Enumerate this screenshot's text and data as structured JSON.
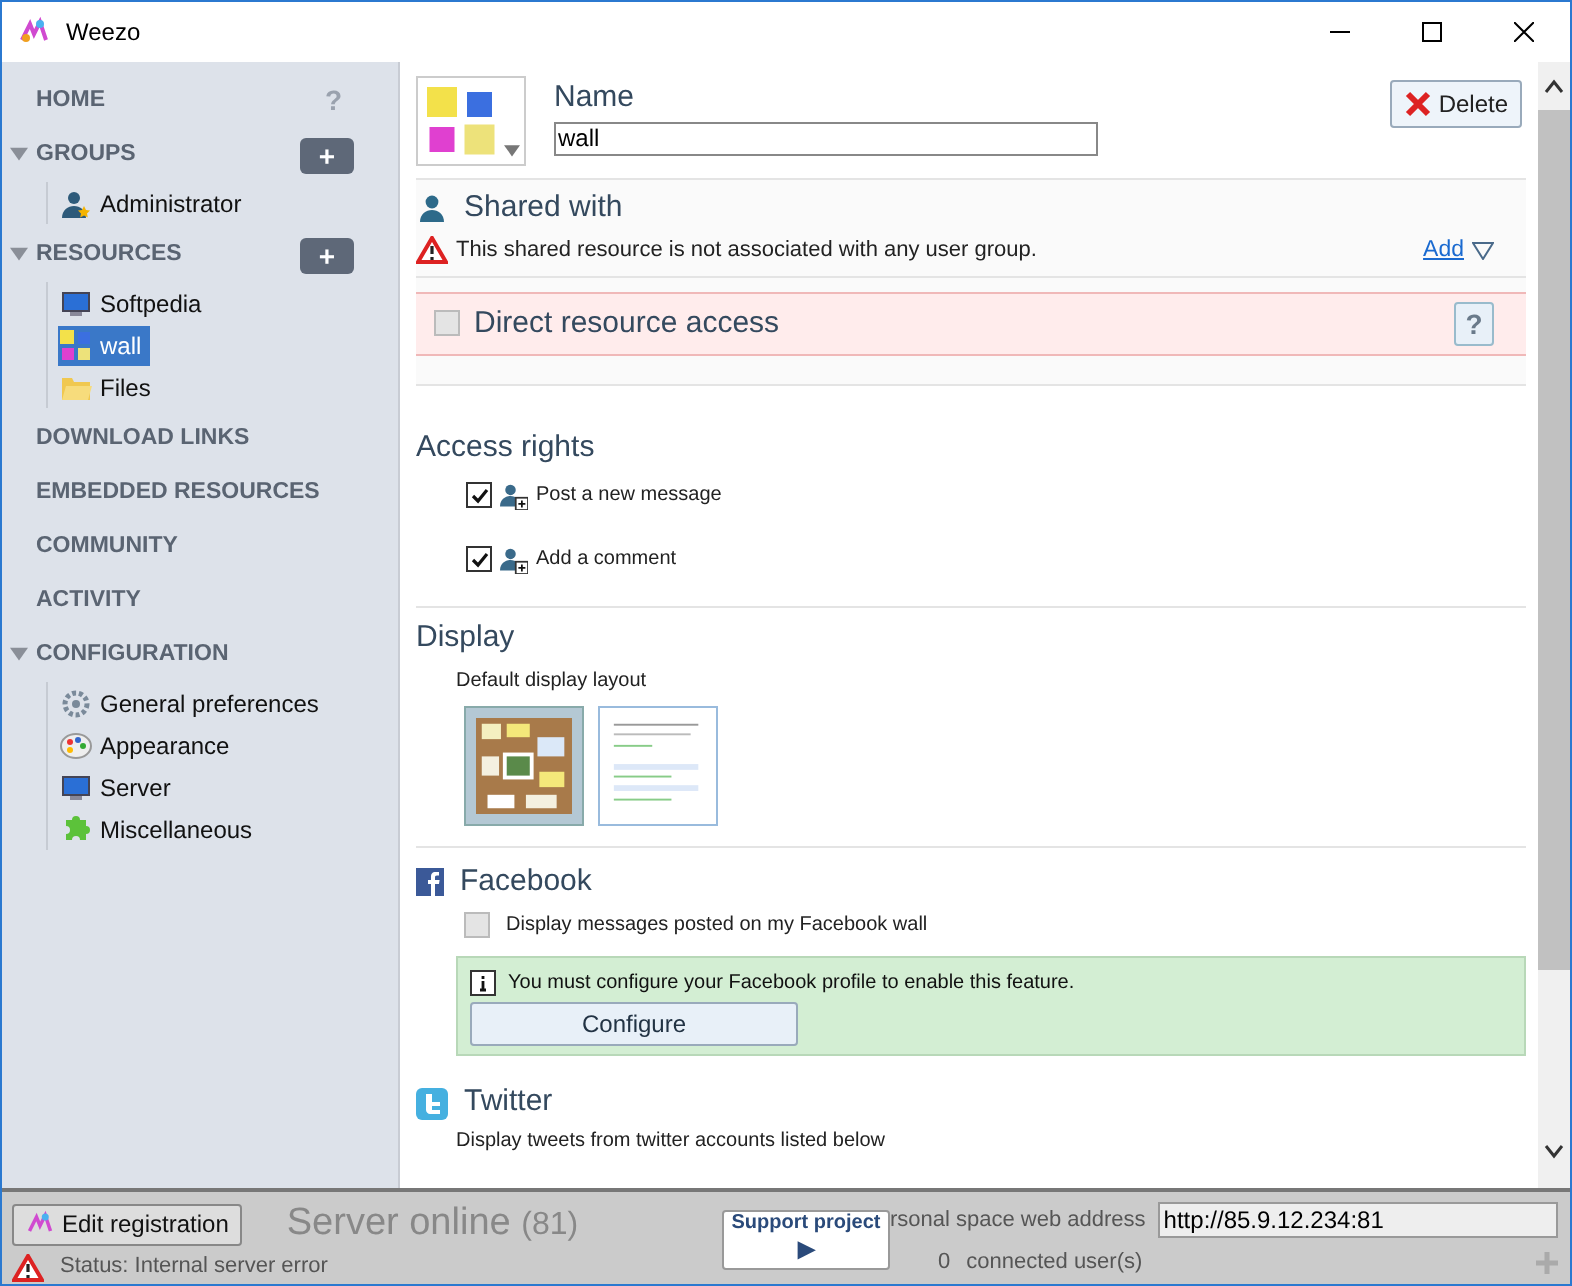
{
  "window": {
    "title": "Weezo"
  },
  "sidebar": {
    "items": [
      {
        "kind": "section",
        "label": "HOME",
        "action": "?"
      },
      {
        "kind": "group",
        "label": "GROUPS",
        "expanded": true,
        "action": "+",
        "children": [
          {
            "label": "Administrator",
            "kind": "user",
            "selected": false
          }
        ]
      },
      {
        "kind": "group",
        "label": "RESOURCES",
        "expanded": true,
        "action": "+",
        "children": [
          {
            "label": "Softpedia",
            "kind": "monitor",
            "selected": false
          },
          {
            "label": "wall",
            "kind": "wall",
            "selected": true
          },
          {
            "label": "Files",
            "kind": "folder",
            "selected": false
          }
        ]
      },
      {
        "kind": "section",
        "label": "DOWNLOAD LINKS"
      },
      {
        "kind": "section",
        "label": "EMBEDDED RESOURCES"
      },
      {
        "kind": "section",
        "label": "COMMUNITY"
      },
      {
        "kind": "section",
        "label": "ACTIVITY"
      },
      {
        "kind": "group",
        "label": "CONFIGURATION",
        "expanded": true,
        "children": [
          {
            "label": "General preferences",
            "kind": "gear",
            "selected": false
          },
          {
            "label": "Appearance",
            "kind": "palette",
            "selected": false
          },
          {
            "label": "Server",
            "kind": "monitor",
            "selected": false
          },
          {
            "label": "Miscellaneous",
            "kind": "puzzle",
            "selected": false
          }
        ]
      }
    ]
  },
  "resource": {
    "name_label": "Name",
    "name_value": "wall",
    "delete_button": "Delete",
    "shared_with": {
      "title": "Shared with",
      "warning": "This shared resource is not associated with any user group.",
      "add_link": "Add"
    },
    "direct_access": {
      "label": "Direct resource access",
      "checked": false,
      "help": "?"
    },
    "access_rights": {
      "title": "Access rights",
      "items": [
        {
          "label": "Post a new message",
          "checked": true
        },
        {
          "label": "Add a comment",
          "checked": true
        }
      ]
    },
    "display": {
      "title": "Display",
      "subtitle": "Default display layout",
      "layouts": [
        {
          "kind": "corkboard",
          "selected": true
        },
        {
          "kind": "list",
          "selected": false
        }
      ]
    },
    "facebook": {
      "title": "Facebook",
      "option": "Display messages posted on my Facebook wall",
      "checked": false,
      "notice": "You must configure your Facebook profile to enable this feature.",
      "button": "Configure"
    },
    "twitter": {
      "title": "Twitter",
      "description": "Display tweets from twitter accounts listed below"
    }
  },
  "status_bar": {
    "edit_button": "Edit registration",
    "server_state": "Server online",
    "server_count": "(81)",
    "status": "Status: Internal server error",
    "support_button": "Support project",
    "support_arrow": "▶",
    "address_label": "rsonal space web address",
    "address": "http://85.9.12.234:81",
    "users_count": "0",
    "users_label": "connected user(s)"
  }
}
